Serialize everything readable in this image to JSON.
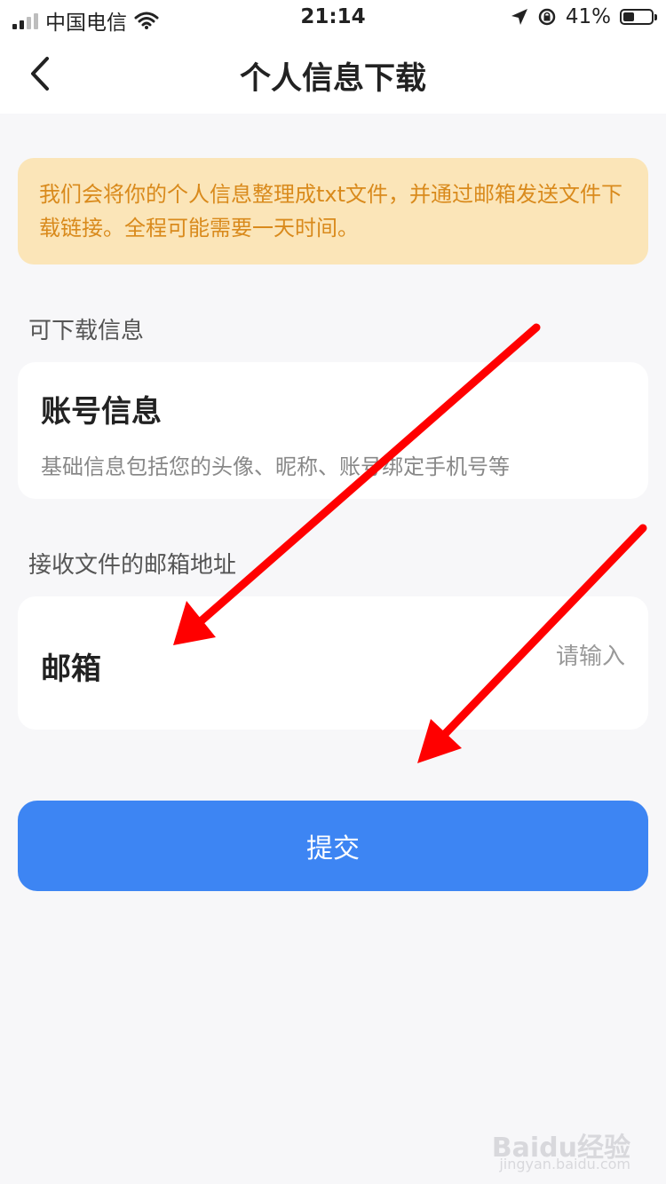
{
  "status_bar": {
    "carrier": "中国电信",
    "time": "21:14",
    "battery": "41%",
    "battery_level": 0.41
  },
  "nav": {
    "back_icon": "chevron-left-icon",
    "title": "个人信息下载"
  },
  "notice": {
    "text": "我们会将你的个人信息整理成txt文件，并通过邮箱发送文件下载链接。全程可能需要一天时间。"
  },
  "downloadable": {
    "section_label": "可下载信息",
    "item_title": "账号信息",
    "item_desc": "基础信息包括您的头像、昵称、账号绑定手机号等"
  },
  "email": {
    "section_label": "接收文件的邮箱地址",
    "label": "邮箱",
    "value": "",
    "placeholder": "请输入"
  },
  "submit_label": "提交",
  "watermark": {
    "logo": "Baidu经验",
    "url": "jingyan.baidu.com"
  },
  "colors": {
    "primary": "#3d85f3",
    "notice_bg": "#fbe5b8",
    "notice_text": "#d98a1c",
    "annotation_arrow": "#ff0000"
  }
}
